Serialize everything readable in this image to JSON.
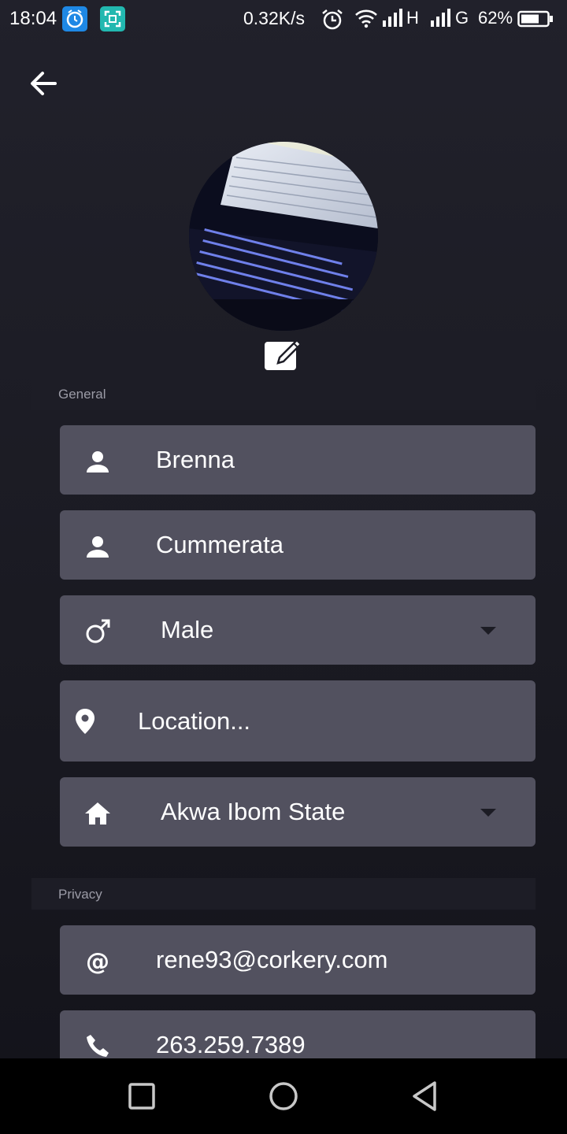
{
  "status_bar": {
    "time": "18:04",
    "net_speed": "0.32K/s",
    "network1": "H",
    "network2": "G",
    "battery": "62%",
    "icons": [
      "clock-app-icon",
      "screenshot-app-icon",
      "alarm-icon",
      "wifi-icon",
      "signal-icon",
      "signal-icon",
      "battery-icon"
    ]
  },
  "header": {
    "back_icon": "arrow-left-icon"
  },
  "sections": {
    "general": "General",
    "privacy": "Privacy"
  },
  "fields": {
    "first_name": "Brenna",
    "last_name": "Cummerata",
    "gender": "Male",
    "location_placeholder": "Location...",
    "state": "Akwa Ibom State",
    "email": "rene93@corkery.com",
    "phone": "263.259.7389"
  },
  "colors": {
    "background": "#1e1e27",
    "field": "#52515f",
    "section_header": "#1d1d26",
    "status_app_blue": "#1e88e5",
    "status_app_teal": "#22b8b0"
  }
}
